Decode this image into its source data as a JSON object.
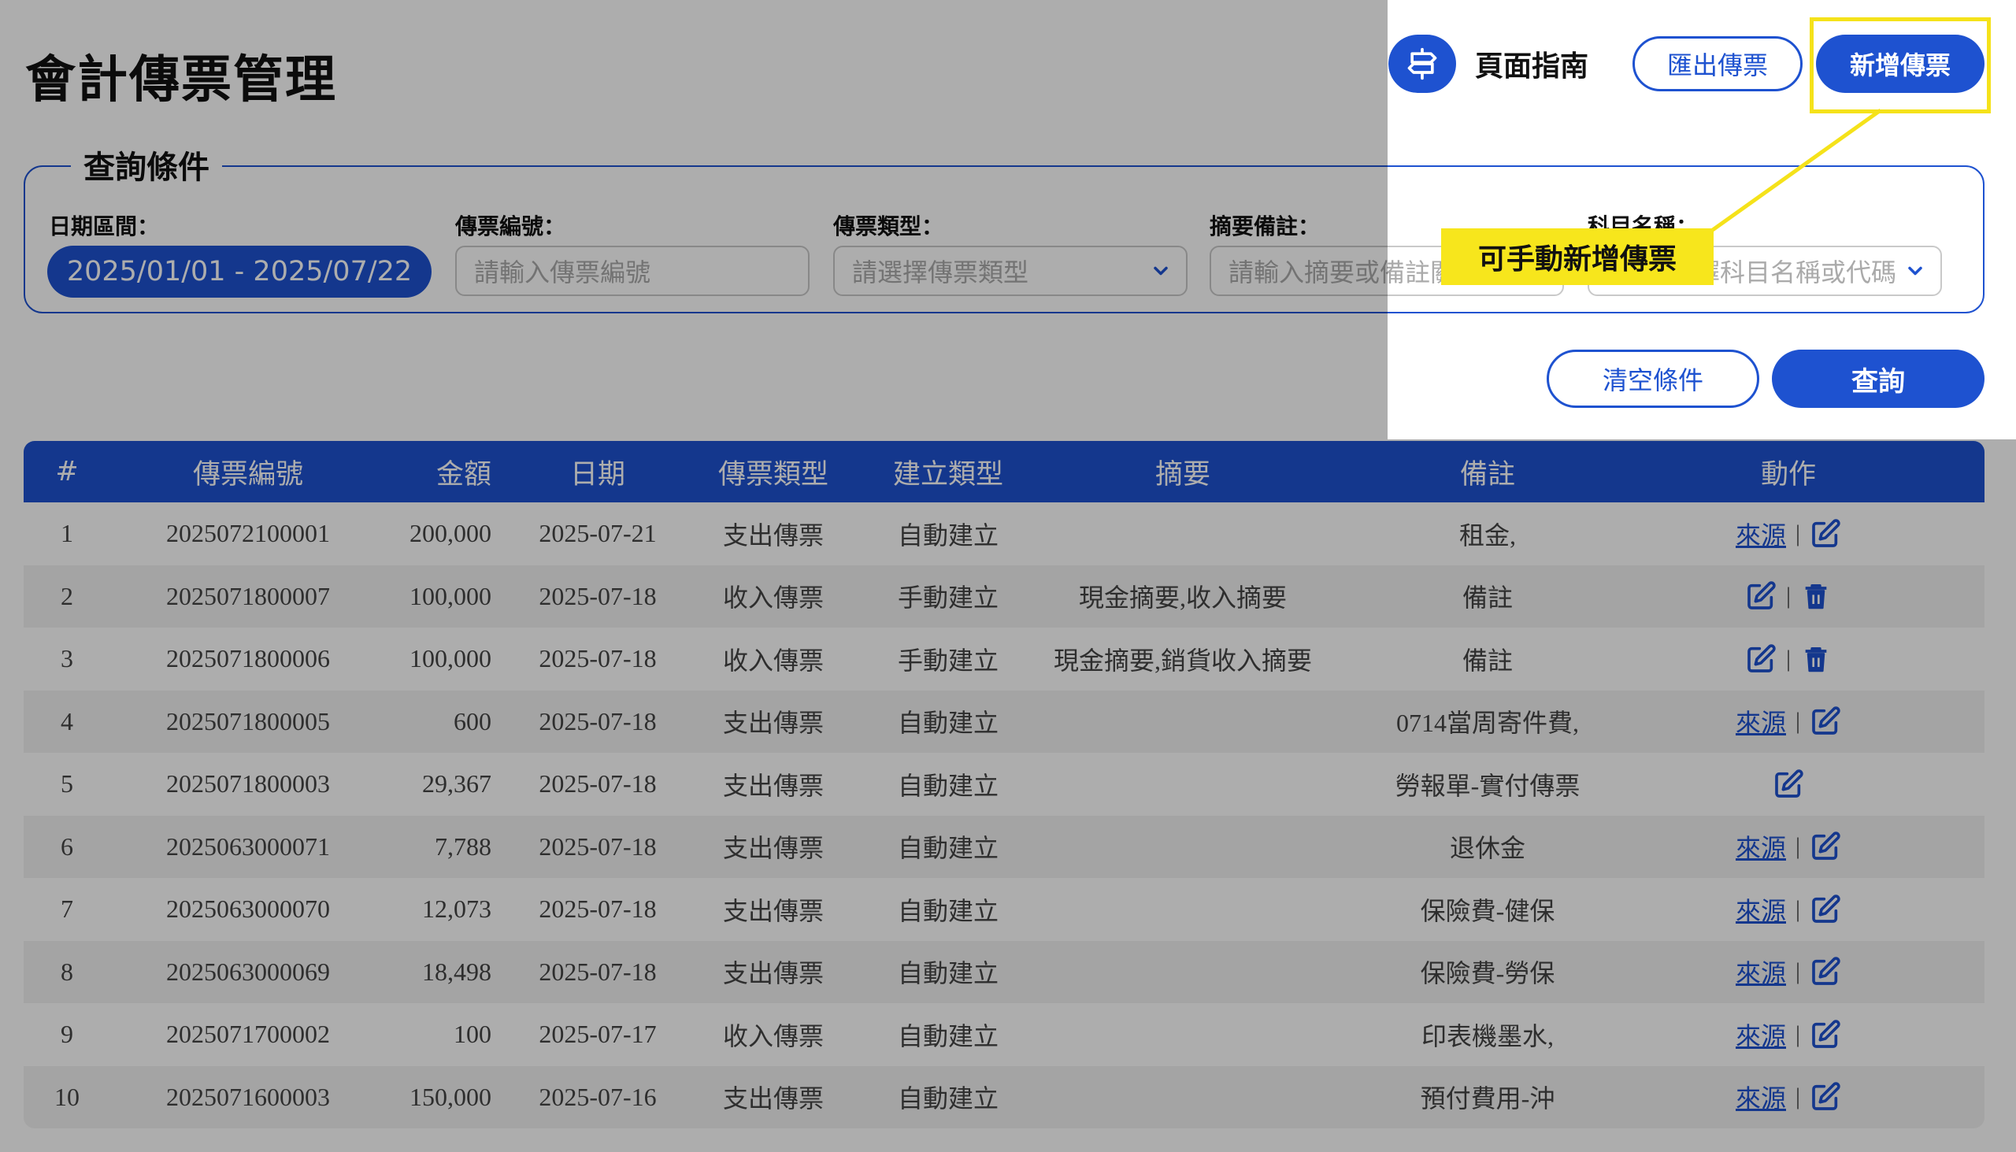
{
  "page_title": "會計傳票管理",
  "header": {
    "guide_label": "頁面指南",
    "export_label": "匯出傳票",
    "add_label": "新增傳票"
  },
  "query": {
    "legend": "查詢條件",
    "date_label": "日期區間：",
    "date_value": "2025/01/01 - 2025/07/22",
    "no_label": "傳票編號：",
    "no_placeholder": "請輸入傳票編號",
    "type_label": "傳票類型：",
    "type_placeholder": "請選擇傳票類型",
    "memo_label": "摘要備註：",
    "memo_placeholder": "請輸入摘要或備註關鍵字",
    "account_label": "科目名稱：",
    "account_placeholder": "請選擇科目名稱或代碼",
    "clear_label": "清空條件",
    "search_label": "查詢"
  },
  "table": {
    "headers": [
      "#",
      "傳票編號",
      "金額",
      "日期",
      "傳票類型",
      "建立類型",
      "摘要",
      "備註",
      "動作"
    ],
    "rows": [
      {
        "idx": "1",
        "no": "2025072100001",
        "amount": "200,000",
        "date": "2025-07-21",
        "type": "支出傳票",
        "create": "自動建立",
        "summary": "",
        "note": "租金,",
        "actions": [
          "source-link",
          "edit-icon"
        ]
      },
      {
        "idx": "2",
        "no": "2025071800007",
        "amount": "100,000",
        "date": "2025-07-18",
        "type": "收入傳票",
        "create": "手動建立",
        "summary": "現金摘要,收入摘要",
        "note": "備註",
        "actions": [
          "edit-icon",
          "trash-icon"
        ]
      },
      {
        "idx": "3",
        "no": "2025071800006",
        "amount": "100,000",
        "date": "2025-07-18",
        "type": "收入傳票",
        "create": "手動建立",
        "summary": "現金摘要,銷貨收入摘要",
        "note": "備註",
        "actions": [
          "edit-icon",
          "trash-icon"
        ]
      },
      {
        "idx": "4",
        "no": "2025071800005",
        "amount": "600",
        "date": "2025-07-18",
        "type": "支出傳票",
        "create": "自動建立",
        "summary": "",
        "note": "0714當周寄件費,",
        "actions": [
          "source-link",
          "edit-icon"
        ]
      },
      {
        "idx": "5",
        "no": "2025071800003",
        "amount": "29,367",
        "date": "2025-07-18",
        "type": "支出傳票",
        "create": "自動建立",
        "summary": "",
        "note": "勞報單-實付傳票",
        "actions": [
          "edit-icon"
        ]
      },
      {
        "idx": "6",
        "no": "2025063000071",
        "amount": "7,788",
        "date": "2025-07-18",
        "type": "支出傳票",
        "create": "自動建立",
        "summary": "",
        "note": "退休金",
        "actions": [
          "source-link",
          "edit-icon"
        ]
      },
      {
        "idx": "7",
        "no": "2025063000070",
        "amount": "12,073",
        "date": "2025-07-18",
        "type": "支出傳票",
        "create": "自動建立",
        "summary": "",
        "note": "保險費-健保",
        "actions": [
          "source-link",
          "edit-icon"
        ]
      },
      {
        "idx": "8",
        "no": "2025063000069",
        "amount": "18,498",
        "date": "2025-07-18",
        "type": "支出傳票",
        "create": "自動建立",
        "summary": "",
        "note": "保險費-勞保",
        "actions": [
          "source-link",
          "edit-icon"
        ]
      },
      {
        "idx": "9",
        "no": "2025071700002",
        "amount": "100",
        "date": "2025-07-17",
        "type": "收入傳票",
        "create": "自動建立",
        "summary": "",
        "note": "印表機墨水,",
        "actions": [
          "source-link",
          "edit-icon"
        ]
      },
      {
        "idx": "10",
        "no": "2025071600003",
        "amount": "150,000",
        "date": "2025-07-16",
        "type": "支出傳票",
        "create": "自動建立",
        "summary": "",
        "note": "預付費用-沖",
        "actions": [
          "source-link",
          "edit-icon"
        ]
      }
    ],
    "source_link_label": "來源",
    "separator": "|"
  },
  "tour": {
    "callout_text": "可手動新增傳票"
  },
  "colors": {
    "primary": "#1e52d0",
    "highlight": "#f5e21a"
  }
}
